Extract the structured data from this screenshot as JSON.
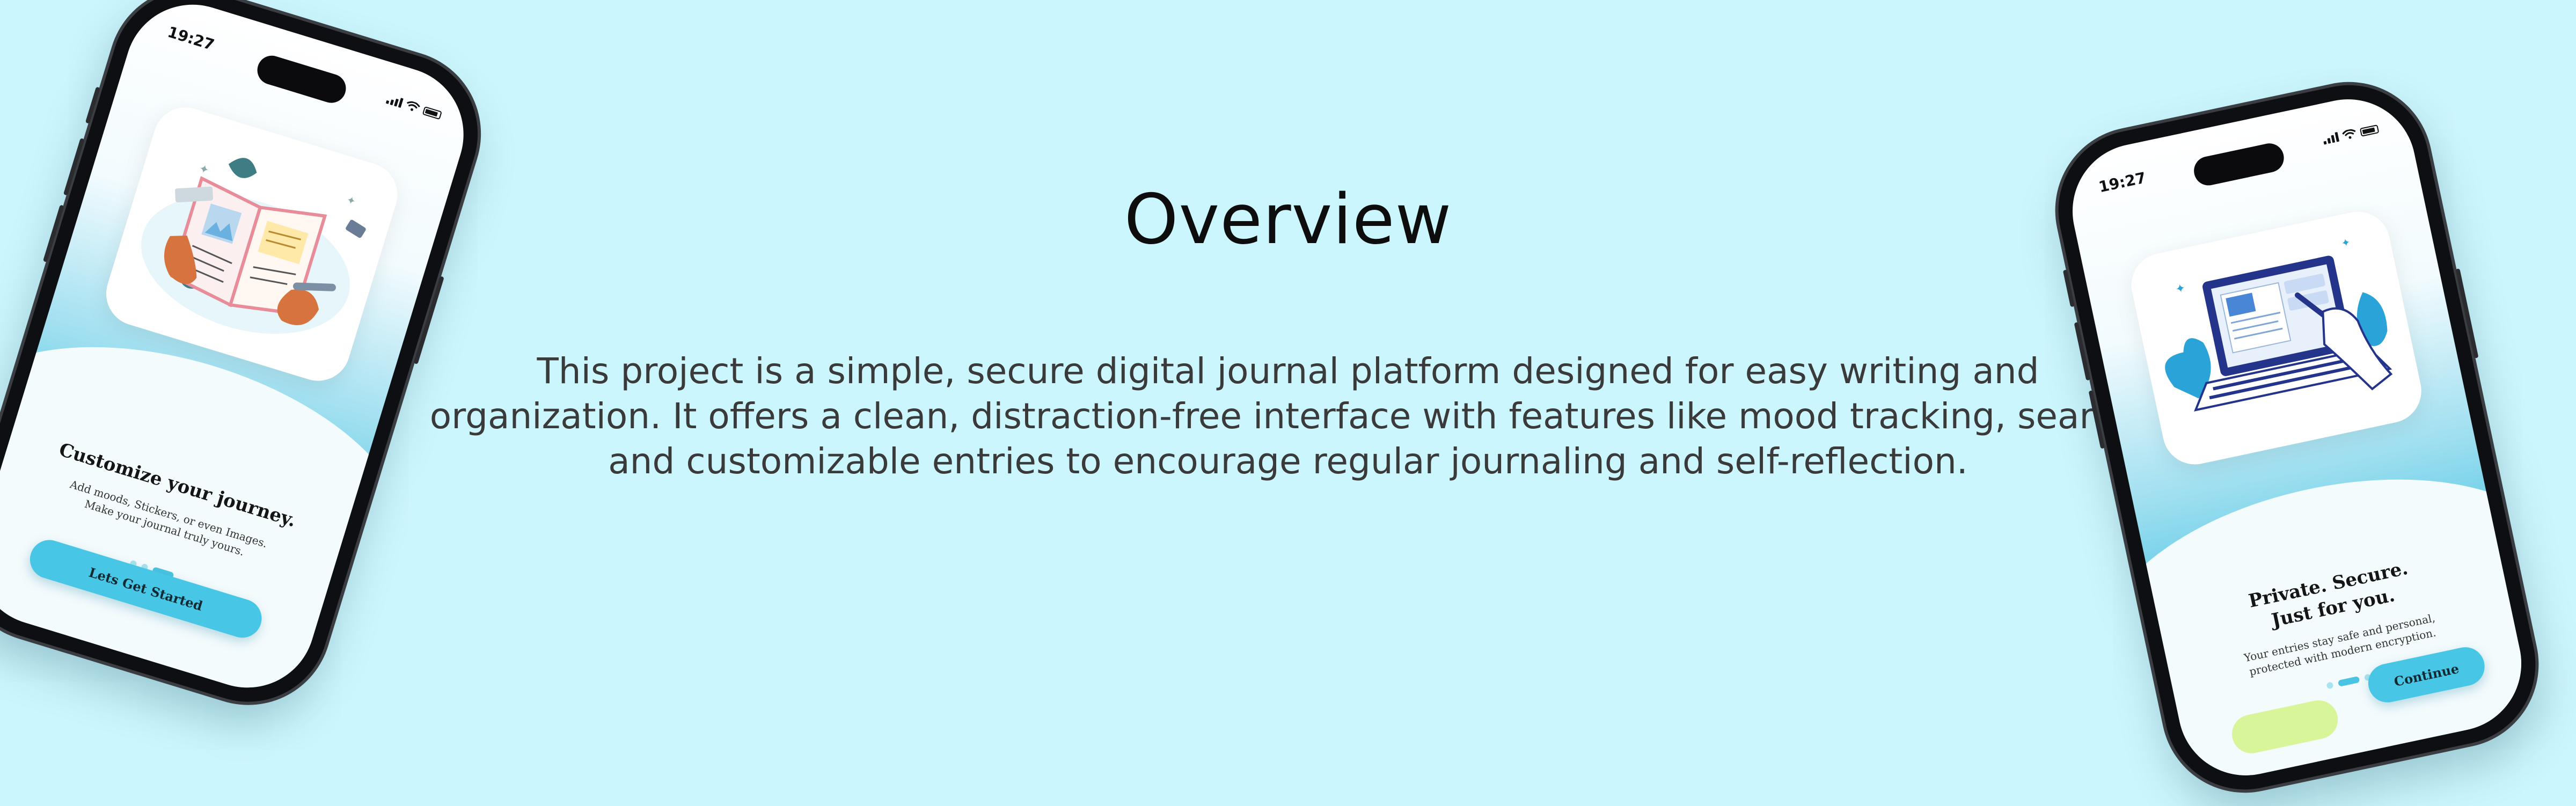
{
  "overview": {
    "title": "Overview",
    "description": "This project is a simple, secure digital journal platform designed for easy writing and organization. It offers a clean, distraction-free interface with features like mood tracking, search, and customizable entries to encourage regular journaling and self-reflection."
  },
  "phone_left": {
    "time": "19:27",
    "title": "Customize your journey.",
    "subtitle_line1": "Add moods, Stickers, or even Images.",
    "subtitle_line2": "Make your journal truly yours.",
    "button_label": "Lets Get Started",
    "page_indicator": {
      "total": 3,
      "active": 3
    },
    "illustration": "open-journal-illustration"
  },
  "phone_right": {
    "time": "19:27",
    "title_line1": "Private. Secure.",
    "title_line2": "Just for you.",
    "subtitle_line1": "Your entries stay safe and personal,",
    "subtitle_line2": "protected with modern encryption.",
    "button_label": "Continue",
    "page_indicator": {
      "total": 3,
      "active": 2
    },
    "illustration": "laptop-writing-illustration"
  },
  "colors": {
    "background": "#ccf6fd",
    "accent": "#48c6e5",
    "secondary_button": "#d8f59a"
  }
}
